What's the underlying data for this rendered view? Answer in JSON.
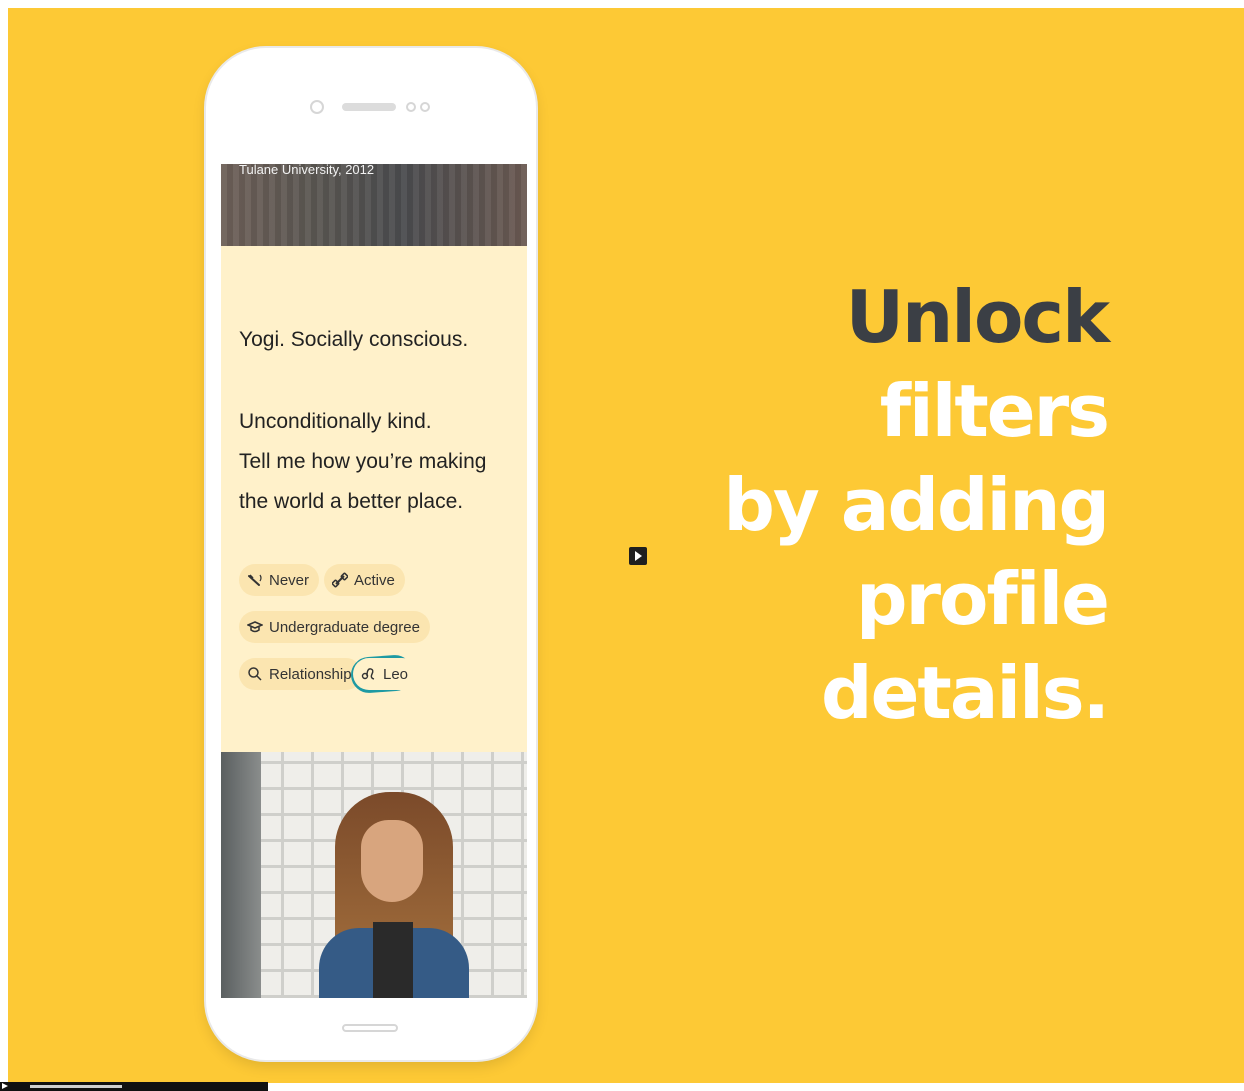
{
  "profile": {
    "education_line": "Tulane University, 2012",
    "bio_line1": "Yogi. Socially conscious.",
    "bio_line2": "Unconditionally kind.",
    "bio_line3": "Tell me how you’re making",
    "bio_line4": "the world a better place.",
    "chips": [
      {
        "label": "Never",
        "icon": "smoking-icon"
      },
      {
        "label": "Active",
        "icon": "dumbbell-icon"
      },
      {
        "label": "Undergraduate degree",
        "icon": "graduation-cap-icon"
      },
      {
        "label": "Relationship",
        "icon": "magnifier-icon"
      },
      {
        "label": "Leo",
        "icon": "zodiac-icon"
      }
    ]
  },
  "headline": {
    "line1": "Unlock",
    "line2": "filters",
    "line3": "by adding",
    "line4": "profile",
    "line5": "details."
  },
  "colors": {
    "background": "#fdc935",
    "headline_dark": "#3b3f45",
    "headline_light": "#ffffff",
    "screen_bg": "#fff1ca",
    "chip_bg": "#fbe5b0",
    "highlight_ring": "#1e9aa3"
  }
}
